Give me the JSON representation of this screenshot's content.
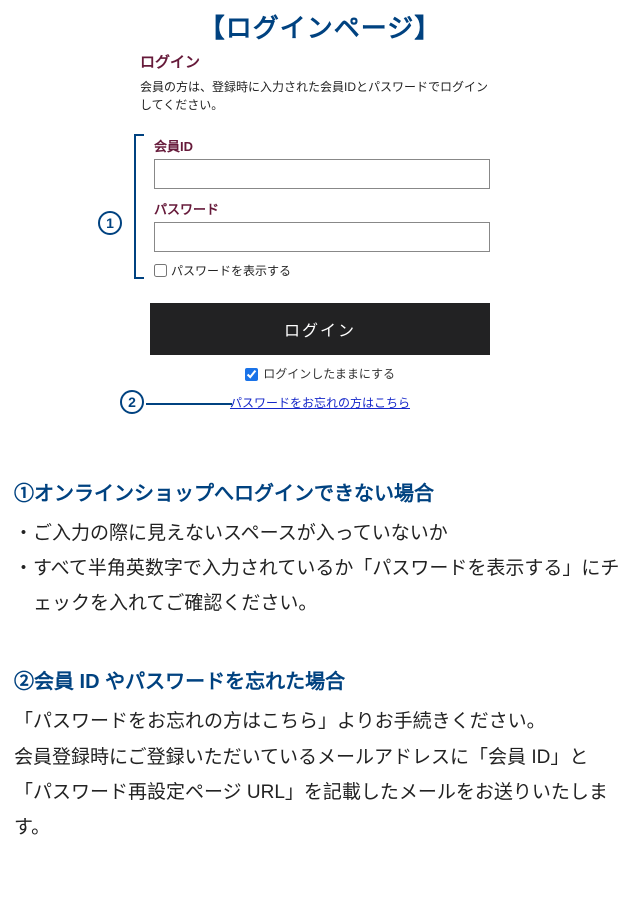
{
  "title": "【ログインページ】",
  "login": {
    "heading": "ログイン",
    "description": "会員の方は、登録時に入力された会員IDとパスワードでログインしてください。",
    "memberIdLabel": "会員ID",
    "memberIdValue": "",
    "passwordLabel": "パスワード",
    "passwordValue": "",
    "showPasswordLabel": "パスワードを表示する",
    "showPasswordChecked": false,
    "buttonLabel": "ログイン",
    "stayLoggedLabel": "ログインしたままにする",
    "stayLoggedChecked": true,
    "forgotLink": "パスワードをお忘れの方はこちら"
  },
  "annotations": {
    "marker1": "1",
    "marker2": "2"
  },
  "instructions": {
    "sec1": {
      "num": "①",
      "title": "オンラインショップへログインできない場合",
      "line1": "・ご入力の際に見えないスペースが入っていないか",
      "line2": "・すべて半角英数字で入力されているか「パスワードを表示する」にチェックを入れてご確認ください。"
    },
    "sec2": {
      "num": "②",
      "title": "会員 ID やパスワードを忘れた場合",
      "body": "「パスワードをお忘れの方はこちら」よりお手続きください。\n会員登録時にご登録いただいているメールアドレスに「会員 ID」と「パスワード再設定ページ URL」を記載したメールをお送りいたします。"
    }
  }
}
